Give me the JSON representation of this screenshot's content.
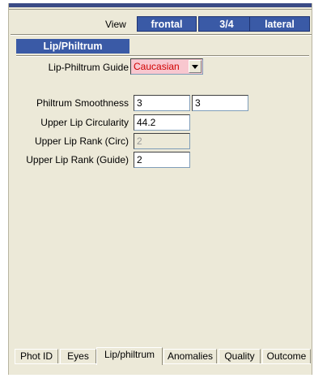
{
  "header": {
    "view_label": "View",
    "view_buttons": [
      "frontal",
      "3/4",
      "lateral"
    ]
  },
  "section": {
    "title": "Lip/Philtrum"
  },
  "form": {
    "guide_label": "Lip-Philtrum Guide",
    "guide_value": "Caucasian",
    "smoothness_label": "Philtrum Smoothness",
    "smoothness_value_1": "3",
    "smoothness_value_2": "3",
    "circularity_label": "Upper Lip Circularity",
    "circularity_value": "44.2",
    "rank_circ_label": "Upper Lip Rank (Circ)",
    "rank_circ_value": "2",
    "rank_guide_label": "Upper Lip Rank (Guide)",
    "rank_guide_value": "2"
  },
  "tabs": [
    "Phot ID",
    "Eyes",
    "Lip/philtrum",
    "Anomalies",
    "Quality",
    "Outcome"
  ],
  "colors": {
    "accent": "#3a5aa6",
    "panel_bg": "#ece9d8",
    "combo_bg": "#f8c7cf",
    "combo_text": "#d10000"
  }
}
